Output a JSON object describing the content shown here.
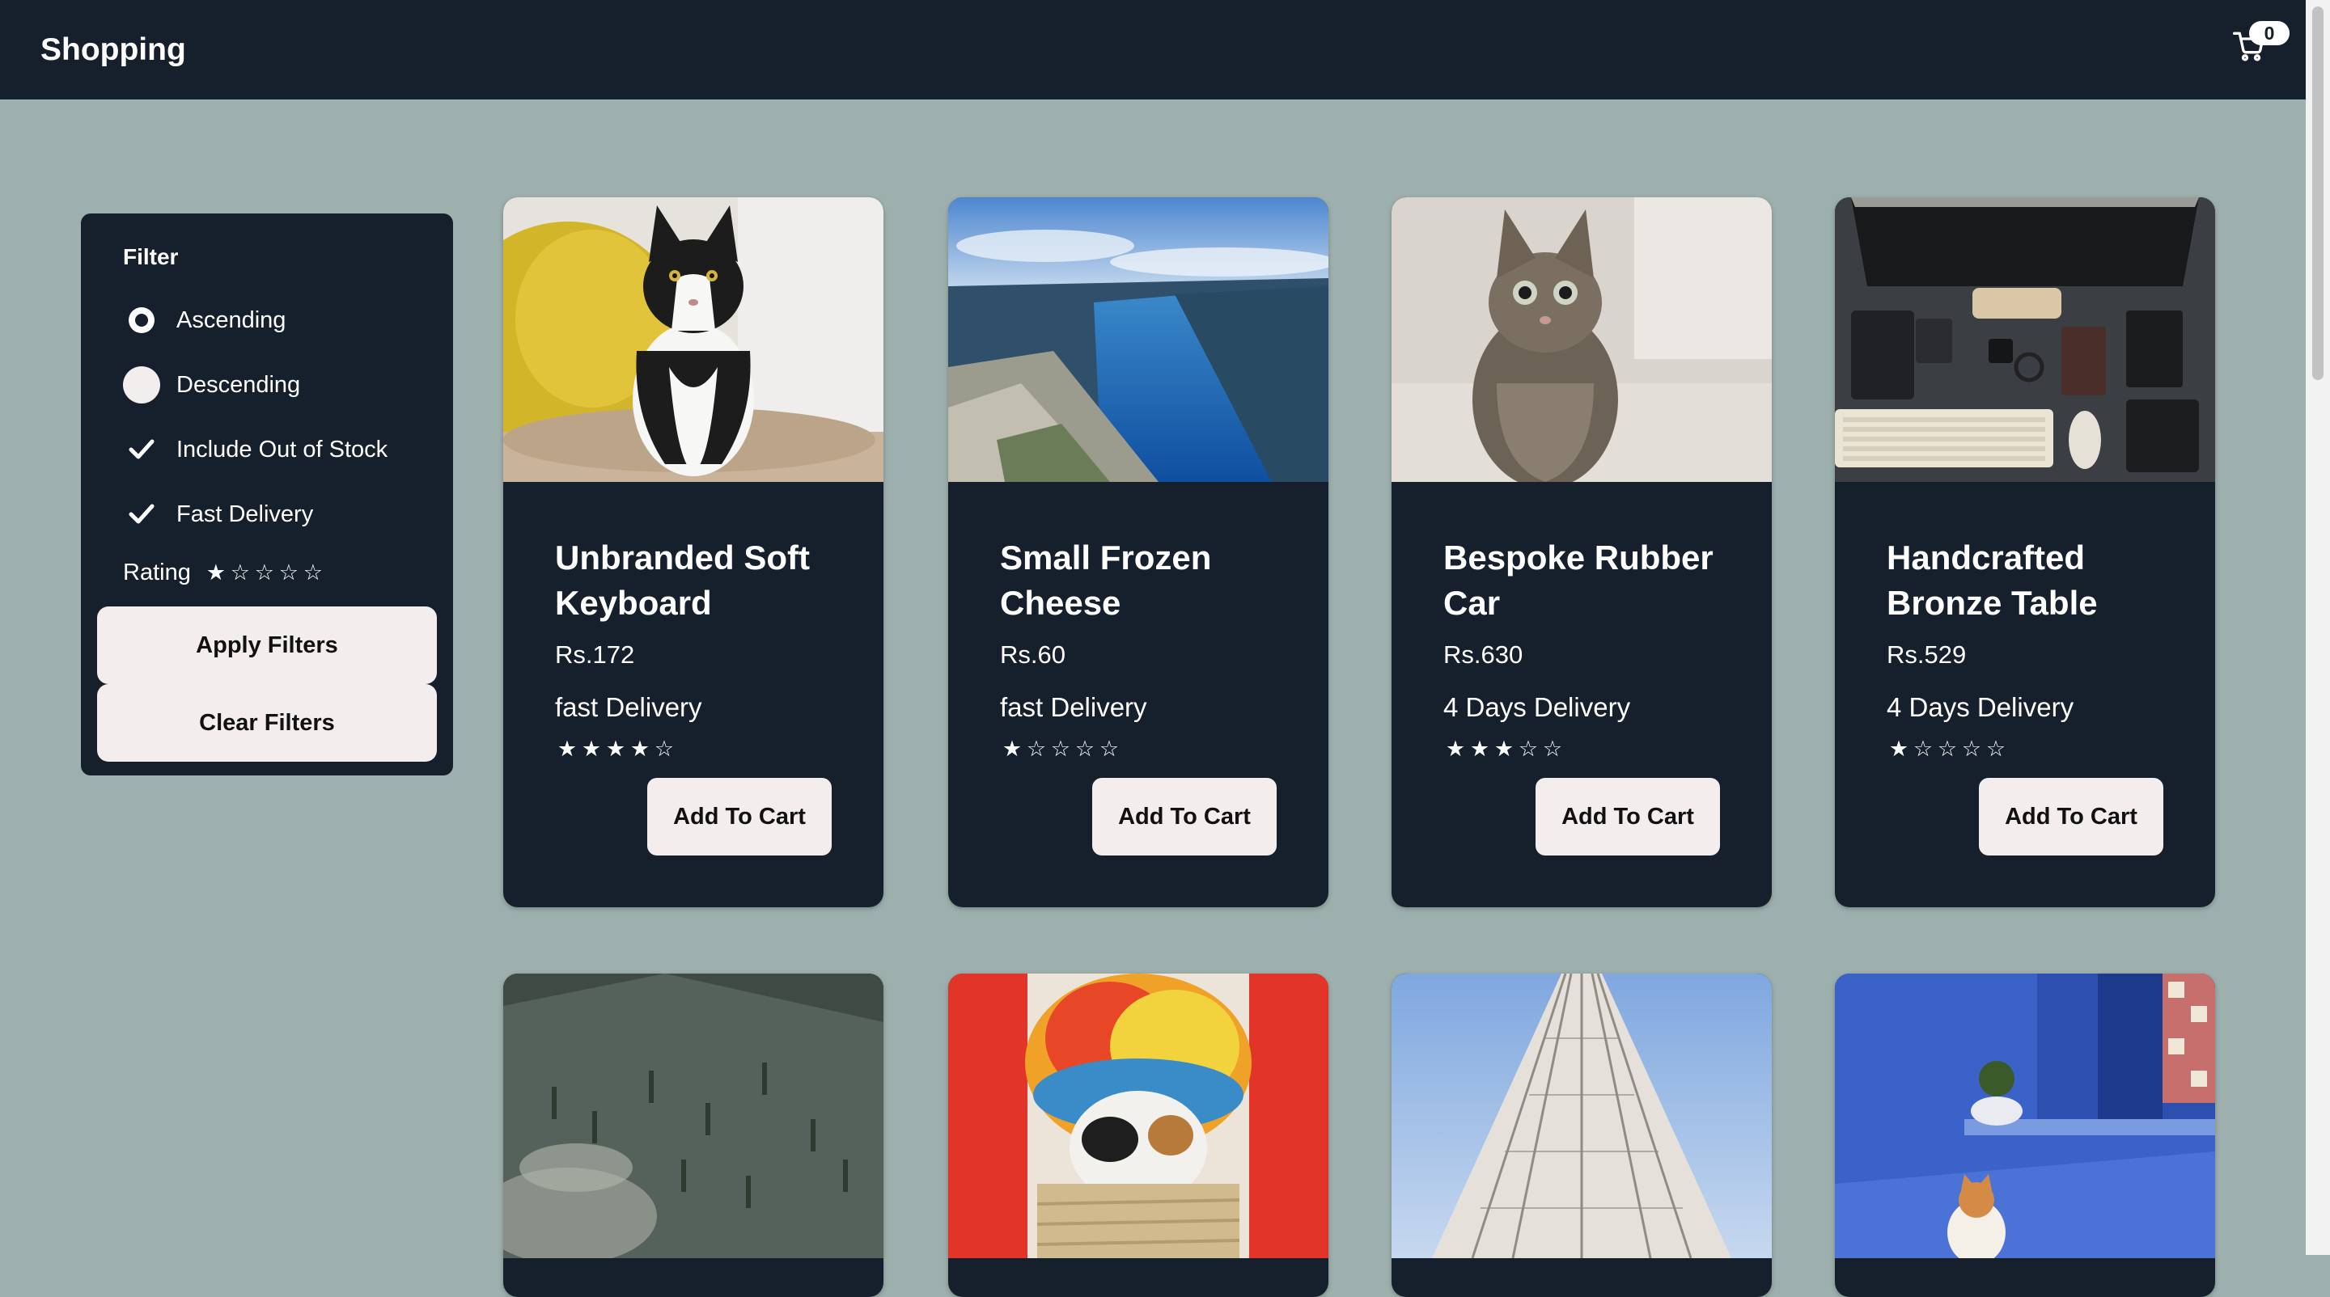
{
  "header": {
    "title": "Shopping",
    "cart_count": "0"
  },
  "filter": {
    "title": "Filter",
    "options": {
      "ascending": "Ascending",
      "descending": "Descending",
      "out_of_stock": "Include Out of Stock",
      "fast_delivery": "Fast Delivery"
    },
    "state": {
      "ascending": true,
      "descending": false,
      "out_of_stock": true,
      "fast_delivery": true
    },
    "rating_label": "Rating",
    "rating_value": 1,
    "apply_label": "Apply Filters",
    "clear_label": "Clear Filters"
  },
  "products": [
    {
      "name": "Unbranded Soft Keyboard",
      "price": "Rs.172",
      "delivery": "fast Delivery",
      "rating": 4,
      "button": "Add To Cart",
      "image": "tuxedo-cat-photo"
    },
    {
      "name": "Small Frozen Cheese",
      "price": "Rs.60",
      "delivery": "fast Delivery",
      "rating": 1,
      "button": "Add To Cart",
      "image": "fjord-landscape-photo"
    },
    {
      "name": "Bespoke Rubber Car",
      "price": "Rs.630",
      "delivery": "4 Days Delivery",
      "rating": 3,
      "button": "Add To Cart",
      "image": "tabby-kitten-photo"
    },
    {
      "name": "Handcrafted Bronze Table",
      "price": "Rs.529",
      "delivery": "4 Days Delivery",
      "rating": 1,
      "button": "Add To Cart",
      "image": "desk-setup-photo"
    },
    {
      "image": "forest-aerial-photo"
    },
    {
      "image": "cat-feather-hat-photo"
    },
    {
      "image": "skyscraper-photo"
    },
    {
      "image": "blue-wall-cat-photo"
    }
  ],
  "colors": {
    "background": "#9eb0ad",
    "panel": "#16202c",
    "button": "#f3eded",
    "text": "#ffffff"
  }
}
